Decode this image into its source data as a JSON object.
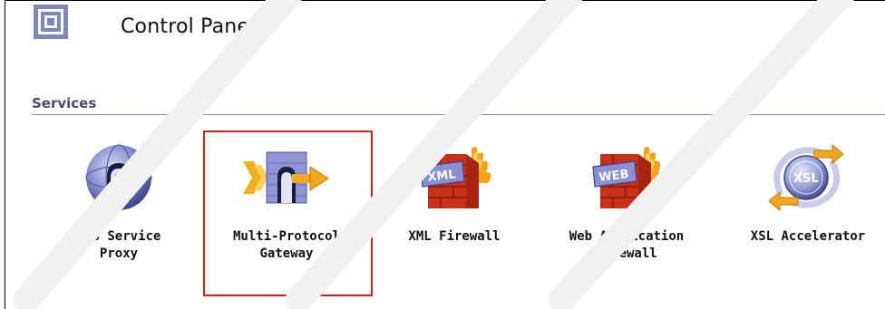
{
  "header": {
    "title": "Control Panel"
  },
  "section": {
    "heading": "Services"
  },
  "services": [
    {
      "label_line1": "Web Service",
      "label_line2": "Proxy",
      "icon": "globe-gateway-icon"
    },
    {
      "label_line1": "Multi-Protocol",
      "label_line2": "Gateway",
      "icon": "protocol-gateway-icon",
      "selected": true
    },
    {
      "label_line1": "XML Firewall",
      "label_line2": "",
      "icon": "xml-firewall-icon",
      "badge": "XML"
    },
    {
      "label_line1": "Web Application",
      "label_line2": "Firewall",
      "icon": "web-firewall-icon",
      "badge": "WEB"
    },
    {
      "label_line1": "XSL Accelerator",
      "label_line2": "",
      "icon": "xsl-accelerator-icon",
      "badge": "XSL"
    }
  ],
  "colors": {
    "selection_border": "#d42020",
    "section_rule": "#8a8fb8",
    "firewall_brick": "#c8301a",
    "flame": "#f3a21b",
    "globe": "#7a7fc4",
    "arrow": "#f0a91c"
  }
}
